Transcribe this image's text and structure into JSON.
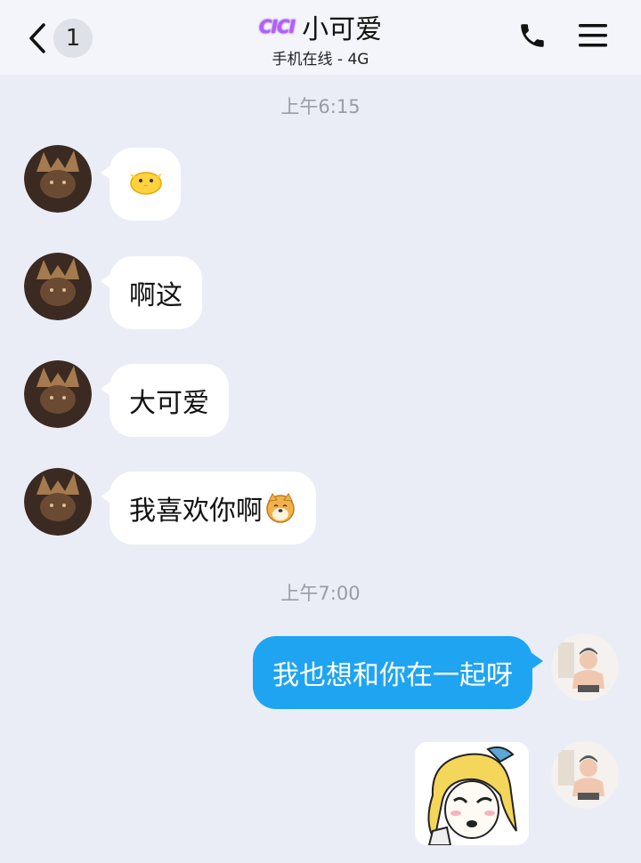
{
  "header": {
    "back_count": "1",
    "badge": "CICI",
    "title": "小可爱",
    "subtitle": "手机在线 - 4G",
    "icons": [
      "back-chevron-icon",
      "phone-icon",
      "menu-icon"
    ]
  },
  "timestamps": [
    "上午6:15",
    "上午7:00"
  ],
  "messages": [
    {
      "side": "in",
      "text": "",
      "emoji": "chick-emoji"
    },
    {
      "side": "in",
      "text": "啊这"
    },
    {
      "side": "in",
      "text": "大可爱"
    },
    {
      "side": "in",
      "text": "我喜欢你啊",
      "emoji": "doge-emoji"
    },
    {
      "side": "out",
      "text": "我也想和你在一起呀"
    },
    {
      "side": "out",
      "text": "",
      "sticker": "anime-girl-sticker"
    }
  ],
  "colors": {
    "background": "#eaedf6",
    "header": "#f3f5fa",
    "incoming_bubble": "#ffffff",
    "outgoing_bubble": "#1fa4f2",
    "timestamp": "#9a9ca4"
  }
}
